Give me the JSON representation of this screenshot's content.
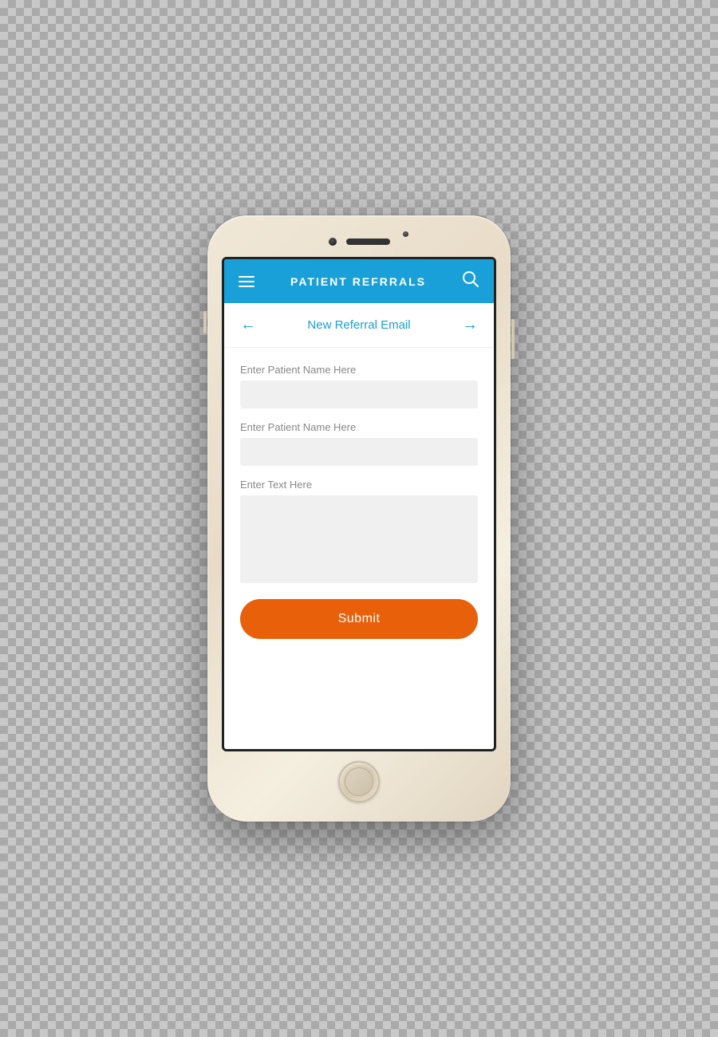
{
  "header": {
    "title": "PATIENT REFRRALS"
  },
  "sub_header": {
    "title": "New Referral Email",
    "back_arrow": "←",
    "forward_arrow": "→"
  },
  "form": {
    "field1_label": "Enter Patient Name Here",
    "field1_placeholder": "",
    "field2_label": "Enter Patient Name Here",
    "field2_placeholder": "",
    "field3_label": "Enter Text Here",
    "field3_placeholder": "",
    "submit_label": "Submit"
  },
  "icons": {
    "hamburger": "≡",
    "search": "○"
  }
}
